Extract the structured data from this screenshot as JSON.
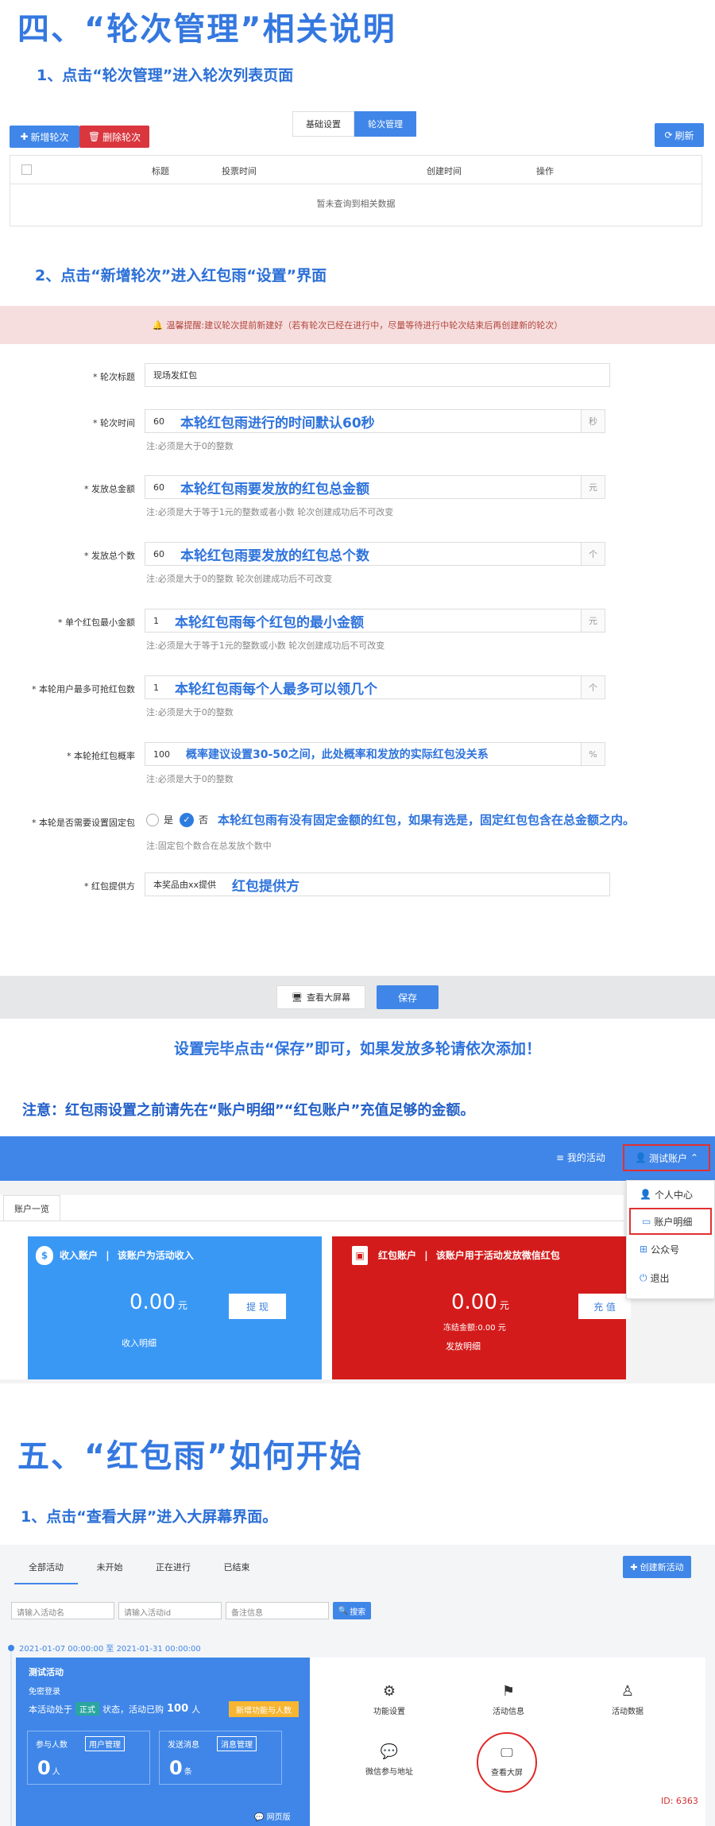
{
  "section4": {
    "title": "四、“轮次管理”相关说明",
    "step1": "1、点击“轮次管理”进入轮次列表页面",
    "toolbar": {
      "add": "新增轮次",
      "delete": "删除轮次",
      "refresh": "刷新"
    },
    "tabs": [
      "基础设置",
      "轮次管理"
    ],
    "table": {
      "headers": [
        "标题",
        "投票时间",
        "创建时间",
        "操作"
      ],
      "empty": "暂未查询到相关数据"
    },
    "step2": "2、点击“新增轮次”进入红包雨“设置”界面",
    "warning": "温馨提醒:建议轮次提前新建好（若有轮次已经在进行中，尽量等待进行中轮次结束后再创建新的轮次）",
    "form": [
      {
        "label": "* 轮次标题",
        "value": "现场发红包",
        "unit": "",
        "note": "",
        "hint": ""
      },
      {
        "label": "* 轮次时间",
        "value": "60",
        "unit": "秒",
        "note": "本轮红包雨进行的时间默认60秒",
        "hint": "注:必须是大于0的整数"
      },
      {
        "label": "* 发放总金额",
        "value": "60",
        "unit": "元",
        "note": "本轮红包雨要发放的红包总金额",
        "hint": "注:必须是大于等于1元的整数或者小数 轮次创建成功后不可改变"
      },
      {
        "label": "* 发放总个数",
        "value": "60",
        "unit": "个",
        "note": "本轮红包雨要发放的红包总个数",
        "hint": "注:必须是大于0的整数 轮次创建成功后不可改变"
      },
      {
        "label": "* 单个红包最小金额",
        "value": "1",
        "unit": "元",
        "note": "本轮红包雨每个红包的最小金额",
        "hint": "注:必须是大于等于1元的整数或小数 轮次创建成功后不可改变"
      },
      {
        "label": "* 本轮用户最多可抢红包数",
        "value": "1",
        "unit": "个",
        "note": "本轮红包雨每个人最多可以领几个",
        "hint": "注:必须是大于0的整数"
      },
      {
        "label": "* 本轮抢红包概率",
        "value": "100",
        "unit": "%",
        "note": "概率建议设置30-50之间，此处概率和发放的实际红包没关系",
        "hint": "注:必须是大于0的整数"
      }
    ],
    "fixed": {
      "label": "* 本轮是否需要设置固定包",
      "yes": "是",
      "no": "否",
      "note": "本轮红包雨有没有固定金额的红包，如果有选是，固定红包包含在总金额之内。",
      "hint": "注:固定包个数合在总发放个数中"
    },
    "provider": {
      "label": "* 红包提供方",
      "value": "本奖品由xx提供",
      "note": "红包提供方"
    },
    "actions": {
      "screen": "查看大屏幕",
      "save": "保存"
    },
    "save_note": "设置完毕点击“保存”即可，如果发放多轮请依次添加！",
    "recharge_note": "注意：红包雨设置之前请先在“账户明细”“红包账户”充值足够的金额。"
  },
  "account": {
    "nav": {
      "my_activity": "我的活动",
      "user": "测试账户"
    },
    "menu": [
      "个人中心",
      "账户明细",
      "公众号",
      "退出"
    ],
    "tab": "账户一览",
    "income": {
      "title": "收入账户",
      "desc": "该账户为活动收入",
      "amount": "0.00",
      "unit": "元",
      "button": "提 现",
      "link": "收入明细"
    },
    "redpack": {
      "title": "红包账户",
      "desc": "该账户用于活动发放微信红包",
      "amount": "0.00",
      "unit": "元",
      "frozen": "冻结金额:0.00 元",
      "button": "充 值",
      "link": "发放明细"
    }
  },
  "section5": {
    "title": "五、“红包雨”如何开始",
    "step1": "1、点击“查看大屏”进入大屏幕界面。",
    "tabs": [
      "全部活动",
      "未开始",
      "正在进行",
      "已结束"
    ],
    "create": "创建新活动",
    "filters": {
      "name": "请输入活动名",
      "id": "请输入活动id",
      "note": "备注信息",
      "search": "搜索"
    },
    "date_range": "2021-01-07 00:00:00 至 2021-01-31 00:00:00",
    "activity": {
      "name": "测试活动",
      "login": "免密登录",
      "status_pre": "本活动处于",
      "status_tag": "正式",
      "status_post": "状态，活动已购",
      "count": "100",
      "count_unit": "人",
      "add_btn": "新增功能与人数",
      "participants_label": "参与人数",
      "participants_btn": "用户管理",
      "participants_value": "0",
      "participants_unit": "人",
      "messages_label": "发送消息",
      "messages_btn": "消息管理",
      "messages_value": "0",
      "messages_unit": "条",
      "web": "网页版"
    },
    "functions": [
      "功能设置",
      "活动信息",
      "活动数据",
      "微信参与地址",
      "查看大屏"
    ],
    "id_label": "ID:",
    "id_value": "6363"
  }
}
